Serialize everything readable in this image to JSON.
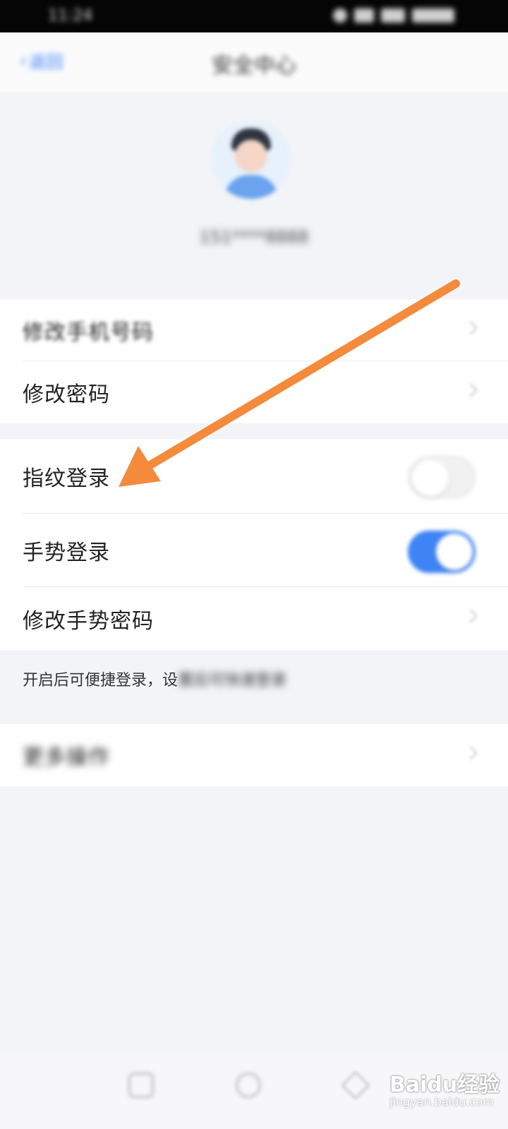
{
  "status_bar": {
    "time": "11:24"
  },
  "nav": {
    "back_label": "返回",
    "title": "安全中心"
  },
  "profile": {
    "username": "151****8888"
  },
  "group1": {
    "items": [
      {
        "label": "修改手机号码"
      },
      {
        "label": "修改密码"
      }
    ]
  },
  "group2": {
    "fingerprint_label": "指纹登录",
    "fingerprint_enabled": false,
    "gesture_label": "手势登录",
    "gesture_enabled": true,
    "gesture_password_label": "修改手势密码"
  },
  "hint": {
    "visible": "开启后可便捷登录，设",
    "blurred": "置后可快速登录"
  },
  "more": {
    "label": "更多操作"
  },
  "watermark": {
    "brand": "Baidu经验",
    "domain": "jingyan.baidu.com"
  },
  "colors": {
    "accent": "#3f84f4",
    "arrow": "#f38a3c",
    "background": "#f3f4f8"
  }
}
